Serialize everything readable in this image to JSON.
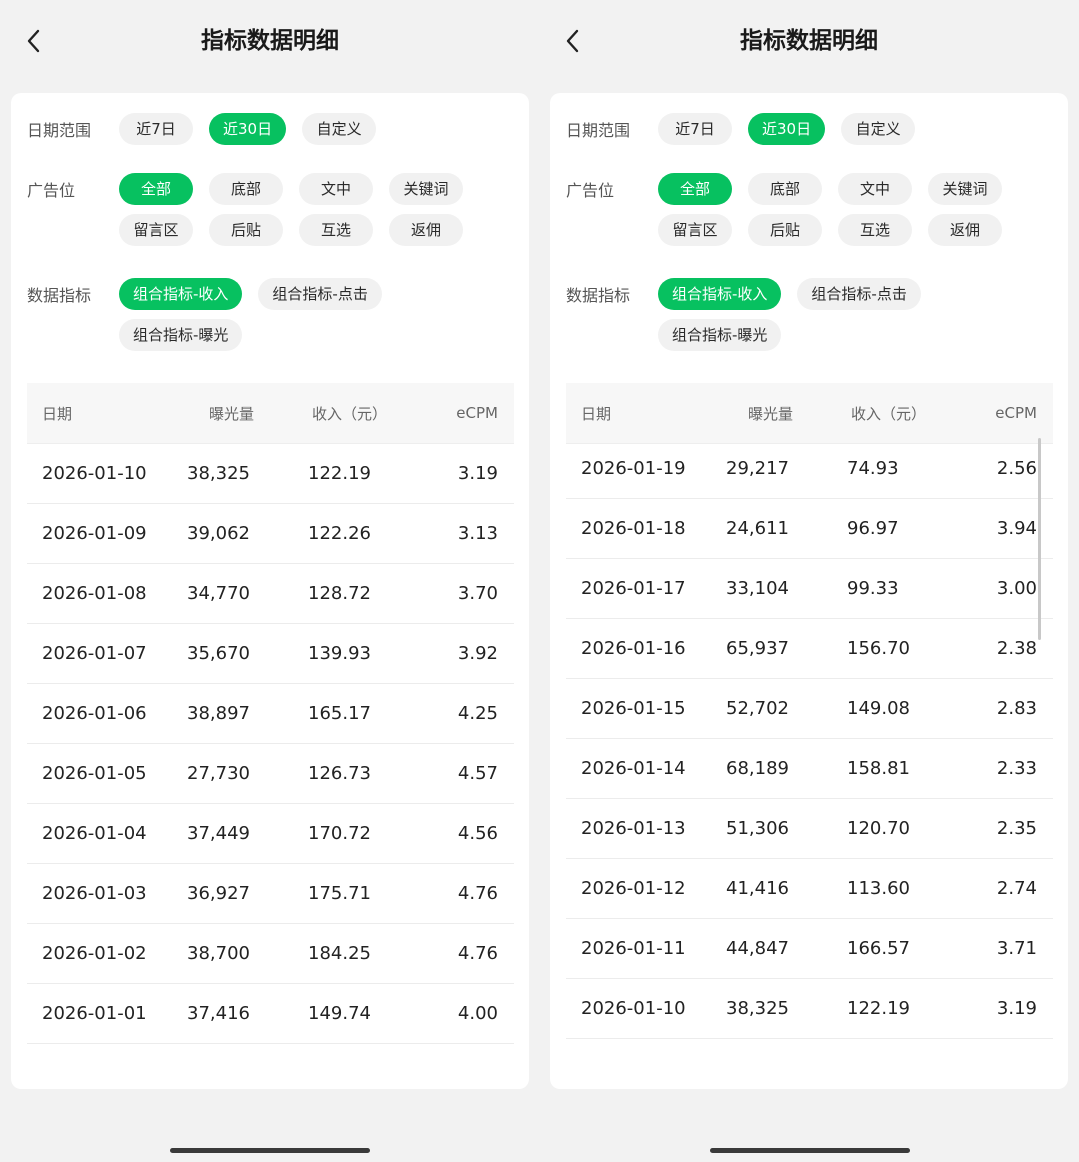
{
  "left": {
    "title": "指标数据明细",
    "filters": {
      "date_range": {
        "label": "日期范围",
        "options": [
          "近7日",
          "近30日",
          "自定义"
        ],
        "selected": 1
      },
      "ad_slot": {
        "label": "广告位",
        "options": [
          "全部",
          "底部",
          "文中",
          "关键词",
          "留言区",
          "后贴",
          "互选",
          "返佣"
        ],
        "selected": 0
      },
      "metric": {
        "label": "数据指标",
        "options": [
          "组合指标-收入",
          "组合指标-点击",
          "组合指标-曝光"
        ],
        "selected": 0
      }
    },
    "table": {
      "headers": [
        "日期",
        "曝光量",
        "收入（元）",
        "eCPM"
      ],
      "rows": [
        [
          "2026-01-10",
          "38,325",
          "122.19",
          "3.19"
        ],
        [
          "2026-01-09",
          "39,062",
          "122.26",
          "3.13"
        ],
        [
          "2026-01-08",
          "34,770",
          "128.72",
          "3.70"
        ],
        [
          "2026-01-07",
          "35,670",
          "139.93",
          "3.92"
        ],
        [
          "2026-01-06",
          "38,897",
          "165.17",
          "4.25"
        ],
        [
          "2026-01-05",
          "27,730",
          "126.73",
          "4.57"
        ],
        [
          "2026-01-04",
          "37,449",
          "170.72",
          "4.56"
        ],
        [
          "2026-01-03",
          "36,927",
          "175.71",
          "4.76"
        ],
        [
          "2026-01-02",
          "38,700",
          "184.25",
          "4.76"
        ],
        [
          "2026-01-01",
          "37,416",
          "149.74",
          "4.00"
        ]
      ]
    }
  },
  "right": {
    "title": "指标数据明细",
    "filters": {
      "date_range": {
        "label": "日期范围",
        "options": [
          "近7日",
          "近30日",
          "自定义"
        ],
        "selected": 1
      },
      "ad_slot": {
        "label": "广告位",
        "options": [
          "全部",
          "底部",
          "文中",
          "关键词",
          "留言区",
          "后贴",
          "互选",
          "返佣"
        ],
        "selected": 0
      },
      "metric": {
        "label": "数据指标",
        "options": [
          "组合指标-收入",
          "组合指标-点击",
          "组合指标-曝光"
        ],
        "selected": 0
      }
    },
    "table": {
      "headers": [
        "日期",
        "曝光量",
        "收入（元）",
        "eCPM"
      ],
      "rows": [
        [
          "2026-01-19",
          "29,217",
          "74.93",
          "2.56"
        ],
        [
          "2026-01-18",
          "24,611",
          "96.97",
          "3.94"
        ],
        [
          "2026-01-17",
          "33,104",
          "99.33",
          "3.00"
        ],
        [
          "2026-01-16",
          "65,937",
          "156.70",
          "2.38"
        ],
        [
          "2026-01-15",
          "52,702",
          "149.08",
          "2.83"
        ],
        [
          "2026-01-14",
          "68,189",
          "158.81",
          "2.33"
        ],
        [
          "2026-01-13",
          "51,306",
          "120.70",
          "2.35"
        ],
        [
          "2026-01-12",
          "41,416",
          "113.60",
          "2.74"
        ],
        [
          "2026-01-11",
          "44,847",
          "166.57",
          "3.71"
        ],
        [
          "2026-01-10",
          "38,325",
          "122.19",
          "3.19"
        ]
      ]
    }
  },
  "colors": {
    "accent": "#07c160",
    "chip_bg": "#f1f1f1",
    "page_bg": "#f2f2f2"
  },
  "icons": {
    "back": "chevron-left-icon"
  }
}
